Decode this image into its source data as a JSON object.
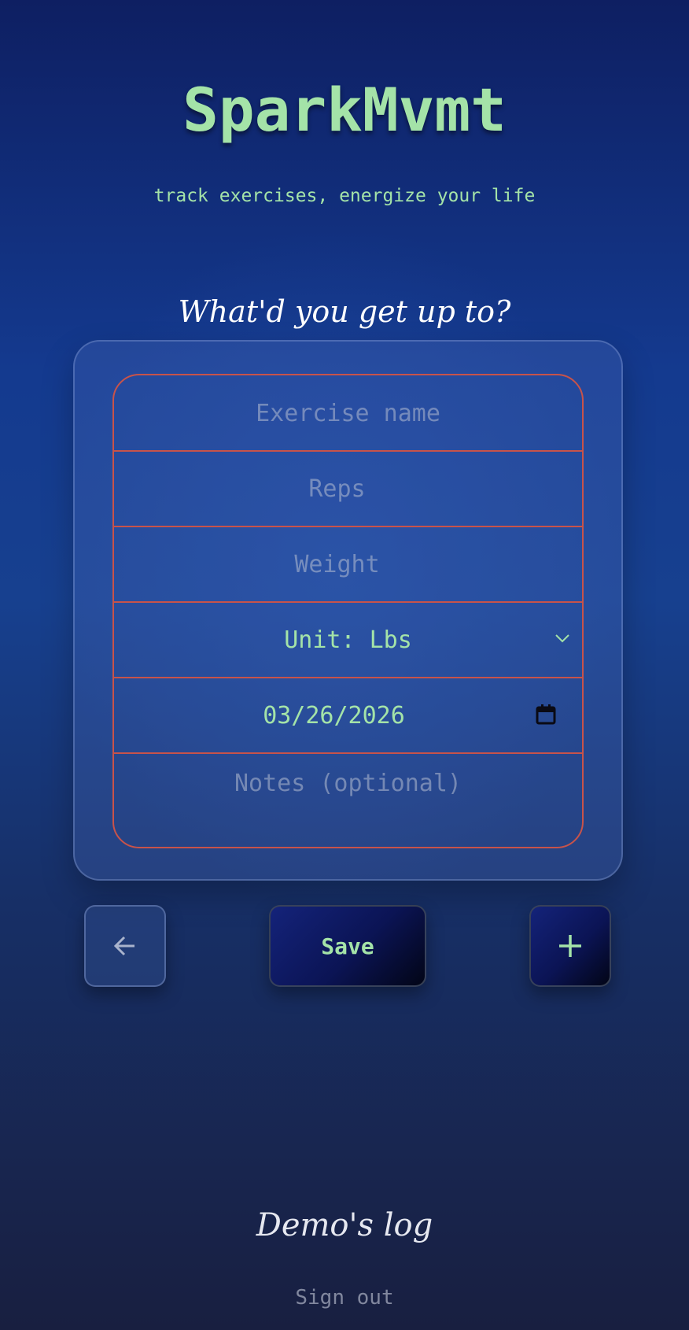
{
  "header": {
    "title": "SparkMvmt",
    "tagline": "track exercises, energize your life"
  },
  "form": {
    "prompt": "What'd you get up to?",
    "exercise_placeholder": "Exercise name",
    "reps_placeholder": "Reps",
    "weight_placeholder": "Weight",
    "unit_value": "Unit: Lbs",
    "date_value": "03/26/2026",
    "notes_placeholder": "Notes (optional)"
  },
  "actions": {
    "back_icon": "arrow-left-icon",
    "save_label": "Save",
    "add_icon": "plus-icon"
  },
  "footer": {
    "log_link": "Demo's log",
    "sign_out": "Sign out"
  },
  "colors": {
    "accent_green": "#a4e3a8",
    "field_border": "#c8534a",
    "background_top": "#0e1f62",
    "background_bottom": "#181f40"
  }
}
